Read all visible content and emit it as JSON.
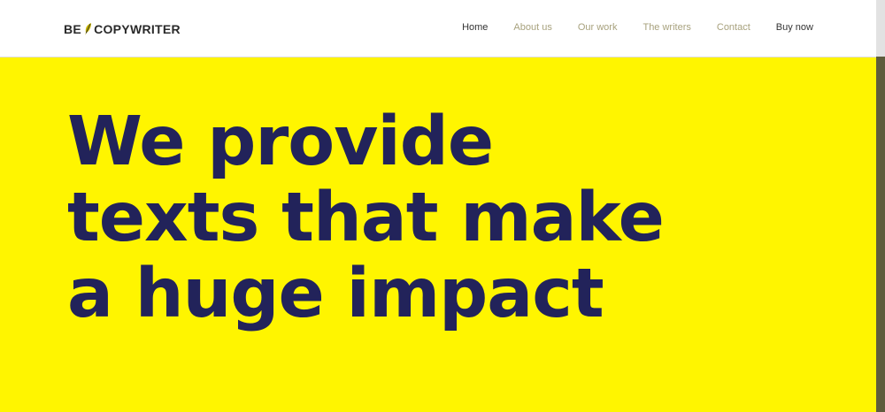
{
  "brand": {
    "part1": "BE",
    "part2": "COPYWRITER",
    "feather_icon": "feather-icon"
  },
  "nav": {
    "items": [
      {
        "label": "Home",
        "active": true
      },
      {
        "label": "About us",
        "active": false
      },
      {
        "label": "Our work",
        "active": false
      },
      {
        "label": "The writers",
        "active": false
      },
      {
        "label": "Contact",
        "active": false
      },
      {
        "label": "Buy now",
        "active": false
      }
    ]
  },
  "hero": {
    "line1": "We provide",
    "line2": "texts that make",
    "line3": "a huge impact"
  },
  "colors": {
    "hero_background": "#fff500",
    "headline": "#22235a",
    "nav_active": "#333333",
    "nav_inactive": "#a8a27e"
  }
}
